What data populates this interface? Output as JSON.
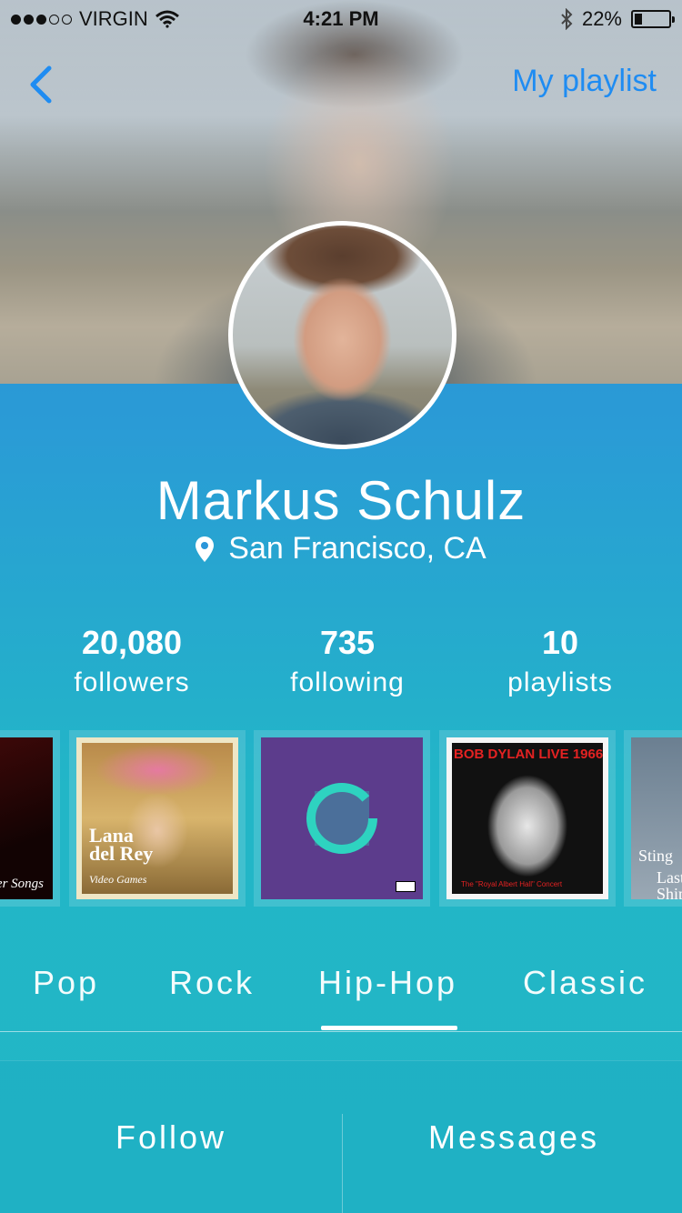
{
  "status_bar": {
    "carrier": "VIRGIN",
    "time": "4:21 PM",
    "battery": "22%",
    "battery_level": 0.22,
    "signal_bars_filled": 3,
    "signal_bars_total": 5
  },
  "nav": {
    "back_icon": "chevron-left-icon",
    "playlist_link": "My playlist",
    "accent_color": "#1f8cf2"
  },
  "profile": {
    "name": "Markus Schulz",
    "location": "San Francisco, CA",
    "location_icon": "map-pin-icon"
  },
  "stats": [
    {
      "value": "20,080",
      "label": "followers"
    },
    {
      "value": "735",
      "label": "following"
    },
    {
      "value": "10",
      "label": "playlists"
    }
  ],
  "albums": [
    {
      "text": "Cover Songs"
    },
    {
      "title": "Lana del Rey",
      "subtitle": "Video Games"
    },
    {
      "icon": "circular-logo-icon"
    },
    {
      "title": "BOB DYLAN LIVE 1966",
      "subtitle": "The \"Royal Albert Hall\" Concert"
    },
    {
      "title": "Sting",
      "subtitle": "Last Ship"
    }
  ],
  "genres": {
    "tabs": [
      "Pop",
      "Rock",
      "Hip-Hop",
      "Classic"
    ],
    "selected": "Hip-Hop"
  },
  "actions": {
    "follow": "Follow",
    "messages": "Messages"
  },
  "colors": {
    "gradient_top": "#2b86dc",
    "gradient_bottom": "#22b7c6",
    "text": "#ffffff"
  }
}
